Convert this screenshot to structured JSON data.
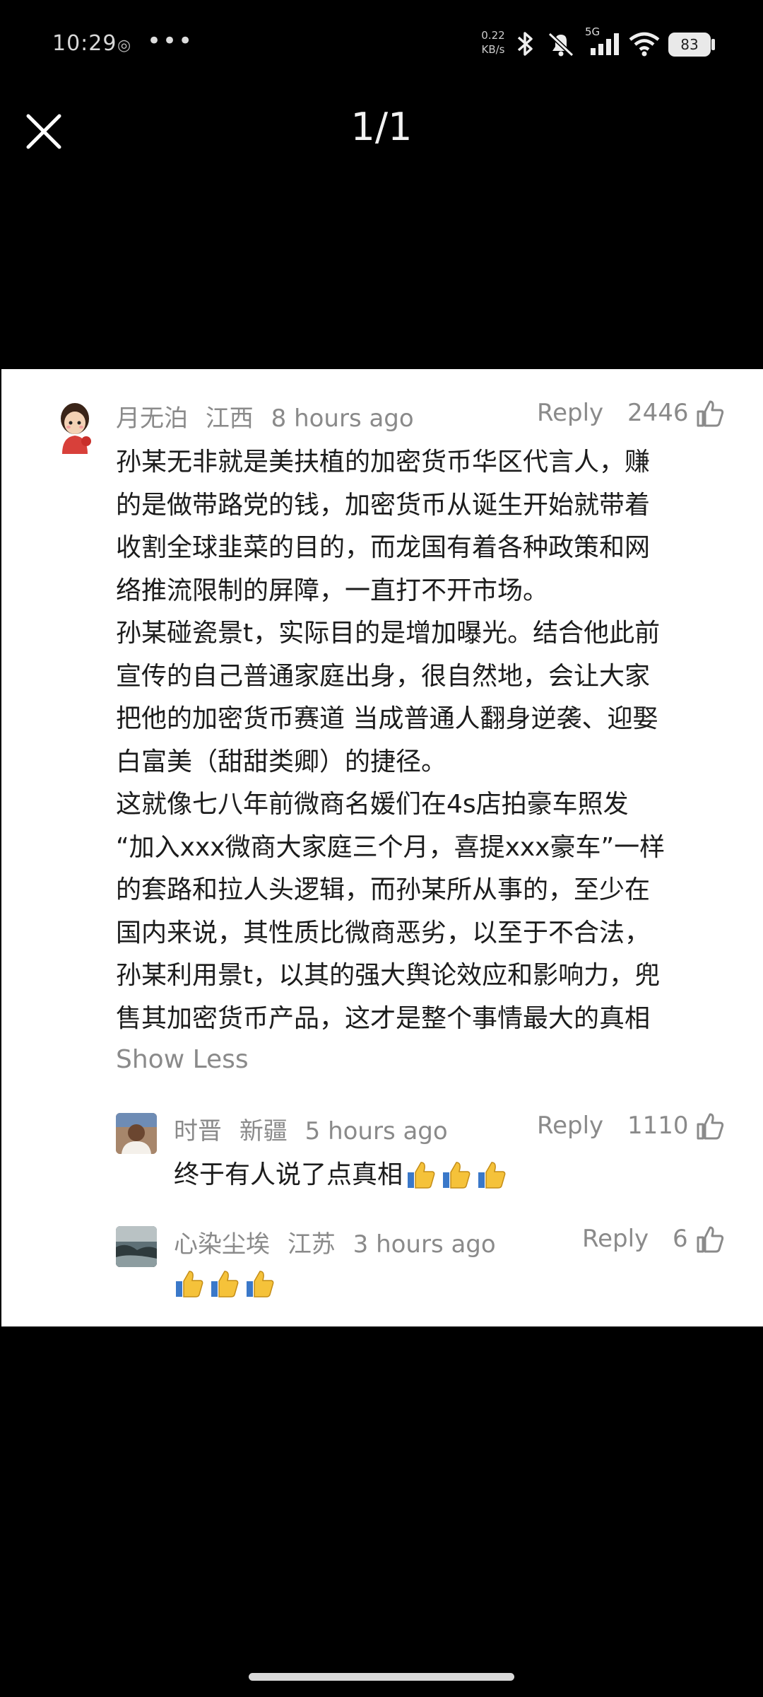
{
  "status_bar": {
    "time": "10:29",
    "net_speed_value": "0.22",
    "net_speed_unit": "KB/s",
    "network": "5G",
    "battery": "83",
    "more": "•••"
  },
  "viewer": {
    "counter": "1/1"
  },
  "comments": [
    {
      "user": "月无泊",
      "region": "江西",
      "time": "8 hours ago",
      "reply_label": "Reply",
      "likes": "2446",
      "lines": [
        "孙某无非就是美扶植的加密货币华区代言人，赚",
        "的是做带路党的钱，加密货币从诞生开始就带着",
        "收割全球韭菜的目的，而龙国有着各种政策和网",
        "络推流限制的屏障，一直打不开市场。",
        "孙某碰瓷景t，实际目的是增加曝光。结合他此前",
        "宣传的自己普通家庭出身，很自然地，会让大家",
        "把他的加密货币赛道 当成普通人翻身逆袭、迎娶",
        "白富美（甜甜类卿）的捷径。",
        "这就像七八年前微商名媛们在4s店拍豪车照发",
        "“加入xxx微商大家庭三个月，喜提xxx豪车”一样",
        "的套路和拉人头逻辑，而孙某所从事的，至少在",
        "国内来说，其性质比微商恶劣，以至于不合法，",
        "孙某利用景t，以其的强大舆论效应和影响力，兜",
        "售其加密货币产品，这才是整个事情最大的真相"
      ],
      "show_less": "Show Less"
    },
    {
      "user": "时晋",
      "region": "新疆",
      "time": "5 hours ago",
      "reply_label": "Reply",
      "likes": "1110",
      "text": "终于有人说了点真相"
    },
    {
      "user": "心染尘埃",
      "region": "江苏",
      "time": "3 hours ago",
      "reply_label": "Reply",
      "likes": "6"
    }
  ],
  "colors": {
    "meta_gray": "#8a8a8a",
    "body_text": "#1c1c1c",
    "thumb_emoji": "#f5c23a"
  }
}
